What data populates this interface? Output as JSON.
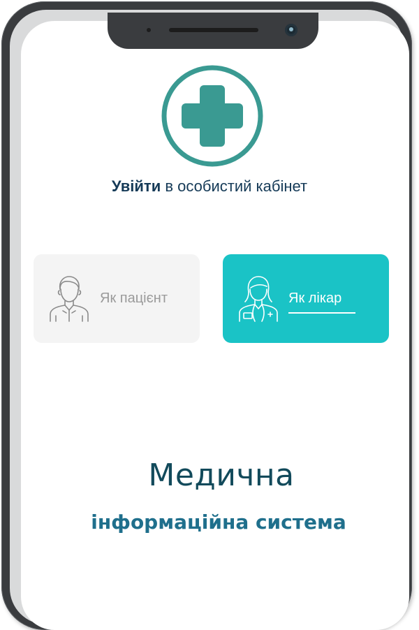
{
  "login": {
    "title_bold": "Увійти",
    "title_rest": " в особистий кабінет"
  },
  "roles": {
    "patient": {
      "label": "Як пацієнт",
      "selected": false,
      "icon": "patient-icon"
    },
    "doctor": {
      "label": "Як лікар",
      "selected": true,
      "icon": "doctor-icon"
    }
  },
  "brand": {
    "title": "Медична",
    "subtitle": "інформаційна система"
  },
  "colors": {
    "accent": "#1ac3c6",
    "logo": "#3a9a92",
    "title_text": "#153a57",
    "brand_title": "#124a5b",
    "brand_subtitle": "#1f6f8c"
  }
}
